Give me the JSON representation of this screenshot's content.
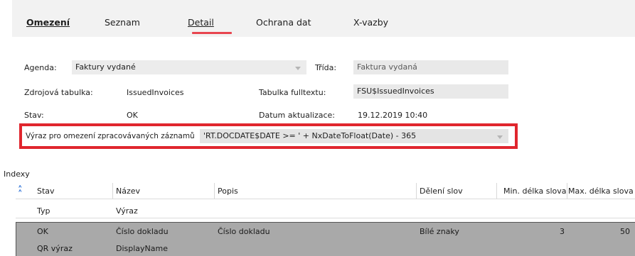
{
  "tabs": [
    {
      "label": "Omezení",
      "underline_char": "O"
    },
    {
      "label": "Seznam"
    },
    {
      "label": "Detail",
      "active": true
    },
    {
      "label": "Ochrana dat"
    },
    {
      "label": "X-vazby",
      "underline_char": "X"
    }
  ],
  "form": {
    "agenda_label": "Agenda:",
    "agenda_value": "Faktury vydané",
    "trida_label": "Třída:",
    "trida_value": "Faktura vydaná",
    "zdrojova_label": "Zdrojová tabulka:",
    "zdrojova_value": "IssuedInvoices",
    "fulltext_label": "Tabulka fulltextu:",
    "fulltext_value": "FSU$IssuedInvoices",
    "stav_label": "Stav:",
    "stav_value": "OK",
    "datum_label": "Datum aktualizace:",
    "datum_value": "19.12.2019 10:40",
    "vyraz_label": "Výraz pro omezení zpracovávaných záznamů",
    "vyraz_value": "'RT.DOCDATE$DATE >= ' + NxDateToFloat(Date) - 365"
  },
  "indexy": {
    "title": "Indexy",
    "headers": [
      "Stav",
      "Název",
      "Popis",
      "Dělení slov",
      "Min. délka slova",
      "Max. délka slova"
    ],
    "subheaders": [
      "Typ",
      "Výraz"
    ],
    "row": {
      "stav": "OK",
      "nazev": "Číslo dokladu",
      "popis": "Číslo dokladu",
      "deleni": "Bílé znaky",
      "min": "3",
      "max": "50",
      "typ": "QR výraz",
      "vyraz": "DisplayName"
    }
  },
  "colors": {
    "accent_underline": "#e8454f",
    "highlight_frame": "#e0262e",
    "field_bg": "#e9e9e9",
    "selected_row_bg": "#a9a9a9",
    "collapse_icon": "#2a6fd6"
  },
  "icons": [
    "chevron-down-icon",
    "collapse-up-icon"
  ]
}
